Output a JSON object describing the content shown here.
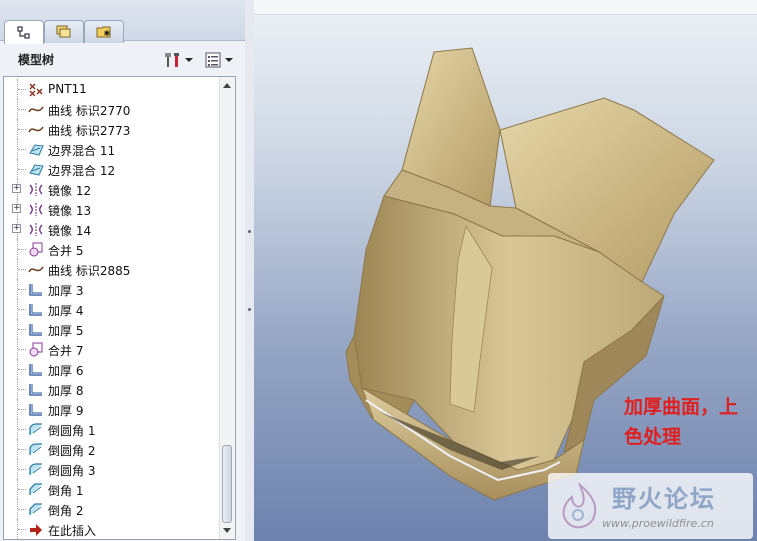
{
  "panel": {
    "title": "模型树",
    "tabs": [
      {
        "name": "model-tree-icon"
      },
      {
        "name": "folder-browser-icon"
      },
      {
        "name": "favorites-icon"
      }
    ]
  },
  "tree": {
    "items": [
      {
        "label": "PNT11",
        "icon": "datum-point-icon",
        "expandable": false
      },
      {
        "label": "曲线 标识2770",
        "icon": "curve-icon",
        "expandable": false
      },
      {
        "label": "曲线 标识2773",
        "icon": "curve-icon",
        "expandable": false
      },
      {
        "label": "边界混合 11",
        "icon": "boundary-blend-icon",
        "expandable": false
      },
      {
        "label": "边界混合 12",
        "icon": "boundary-blend-icon",
        "expandable": false
      },
      {
        "label": "镜像 12",
        "icon": "mirror-icon",
        "expandable": true
      },
      {
        "label": "镜像 13",
        "icon": "mirror-icon",
        "expandable": true
      },
      {
        "label": "镜像 14",
        "icon": "mirror-icon",
        "expandable": true
      },
      {
        "label": "合并 5",
        "icon": "merge-icon",
        "expandable": false
      },
      {
        "label": "曲线 标识2885",
        "icon": "curve-icon",
        "expandable": false
      },
      {
        "label": "加厚 3",
        "icon": "thicken-icon",
        "expandable": false
      },
      {
        "label": "加厚 4",
        "icon": "thicken-icon",
        "expandable": false
      },
      {
        "label": "加厚 5",
        "icon": "thicken-icon",
        "expandable": false
      },
      {
        "label": "合并 7",
        "icon": "merge-icon",
        "expandable": false
      },
      {
        "label": "加厚 6",
        "icon": "thicken-icon",
        "expandable": false
      },
      {
        "label": "加厚 8",
        "icon": "thicken-icon",
        "expandable": false
      },
      {
        "label": "加厚 9",
        "icon": "thicken-icon",
        "expandable": false
      },
      {
        "label": "倒圆角 1",
        "icon": "round-icon",
        "expandable": false
      },
      {
        "label": "倒圆角 2",
        "icon": "round-icon",
        "expandable": false
      },
      {
        "label": "倒圆角 3",
        "icon": "round-icon",
        "expandable": false
      },
      {
        "label": "倒角 1",
        "icon": "chamfer-icon",
        "expandable": false
      },
      {
        "label": "倒角 2",
        "icon": "chamfer-icon",
        "expandable": false
      },
      {
        "label": "在此插入",
        "icon": "insert-here-arrow-icon",
        "expandable": false
      }
    ]
  },
  "annotation": {
    "line1": "加厚曲面，上",
    "line2": "色处理"
  },
  "watermark": {
    "title": "野火论坛",
    "url": "www.proewildfire.cn"
  },
  "colors": {
    "model_surface": "#cbb88a",
    "annotation": "#e01f1f"
  }
}
